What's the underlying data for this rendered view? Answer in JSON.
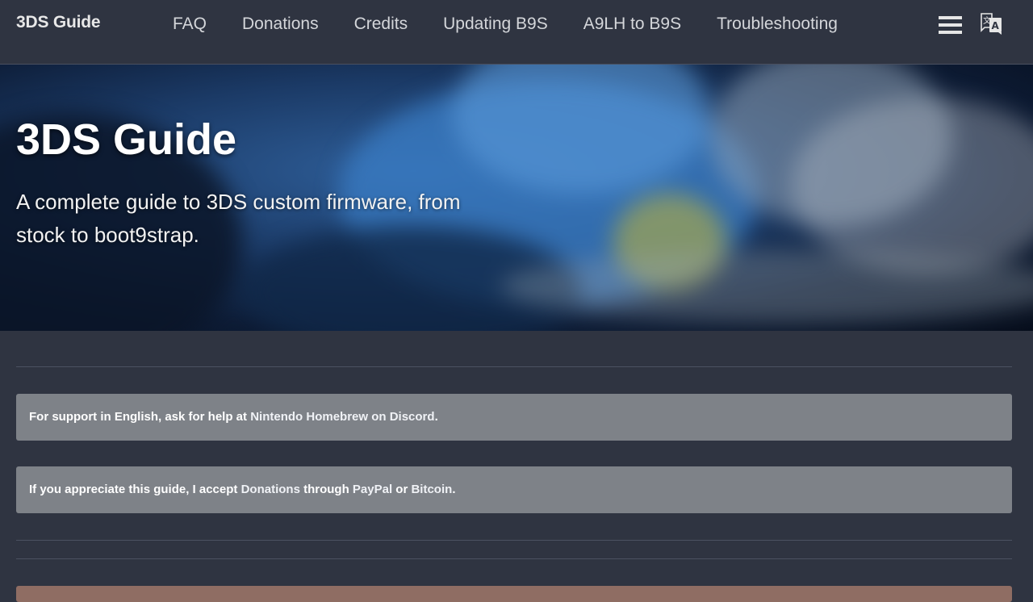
{
  "navbar": {
    "brand": "3DS Guide",
    "links": [
      "FAQ",
      "Donations",
      "Credits",
      "Updating B9S",
      "A9LH to B9S",
      "Troubleshooting"
    ],
    "menu_icon": "hamburger-menu-icon",
    "translate_icon": "translate-icon"
  },
  "hero": {
    "title": "3DS Guide",
    "subtitle": "A complete guide to 3DS custom firmware, from stock to boot9strap."
  },
  "notices": {
    "support": {
      "before": "For support in English, ask for help at ",
      "link": "Nintendo Homebrew on Discord",
      "after": "."
    },
    "donate": {
      "before": "If you appreciate this guide, I accept ",
      "link1": "Donations",
      "middle1": " through ",
      "link2": "PayPal",
      "middle2": " or ",
      "link3": "Bitcoin",
      "after": "."
    }
  },
  "colors": {
    "background": "#2f3441",
    "notice": "#7e8288",
    "warning": "#8f6d63"
  }
}
